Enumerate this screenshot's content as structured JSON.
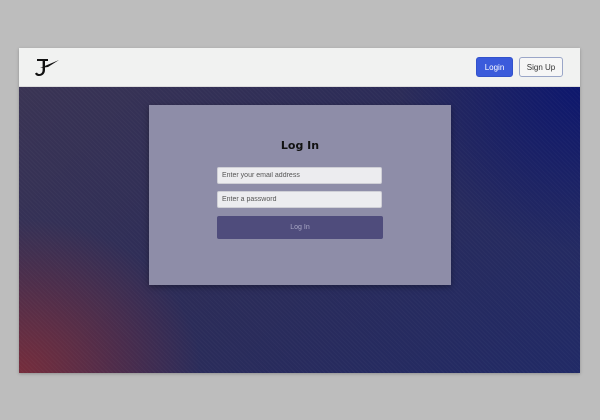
{
  "navbar": {
    "logo_icon": "brand-logo-icon",
    "login_label": "Login",
    "signup_label": "Sign Up"
  },
  "form": {
    "title": "Log In",
    "email_placeholder": "Enter your email address",
    "password_placeholder": "Enter a password",
    "submit_label": "Log In"
  },
  "colors": {
    "primary_button": "#3b5bdb",
    "card_background": "#8e8da8",
    "submit_button": "#4f4c7c",
    "navbar_background": "#f1f2f1"
  }
}
